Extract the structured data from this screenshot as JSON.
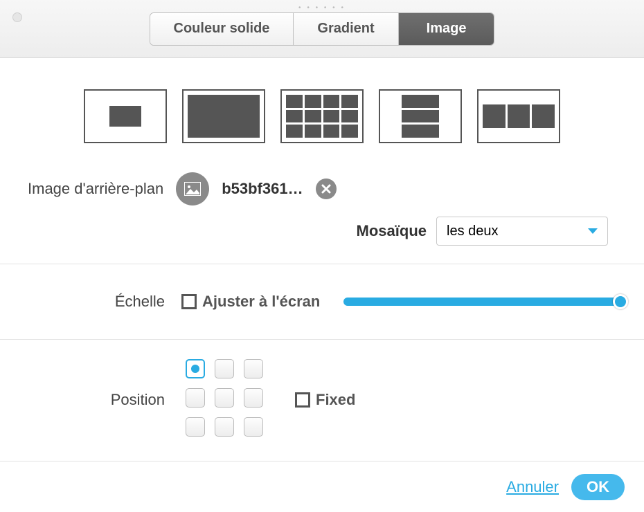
{
  "tabs": {
    "solid": "Couleur solide",
    "gradient": "Gradient",
    "image": "Image",
    "active": "image"
  },
  "bg_image": {
    "label": "Image d'arrière-plan",
    "filename": "b53bf361…"
  },
  "mosaique": {
    "label": "Mosaïque",
    "value": "les deux"
  },
  "echelle": {
    "label": "Échelle",
    "fit_label": "Ajuster à l'écran",
    "fit_checked": false,
    "slider_value": 100
  },
  "position": {
    "label": "Position",
    "selected_index": 0,
    "fixed_label": "Fixed",
    "fixed_checked": false
  },
  "footer": {
    "cancel": "Annuler",
    "ok": "OK"
  }
}
